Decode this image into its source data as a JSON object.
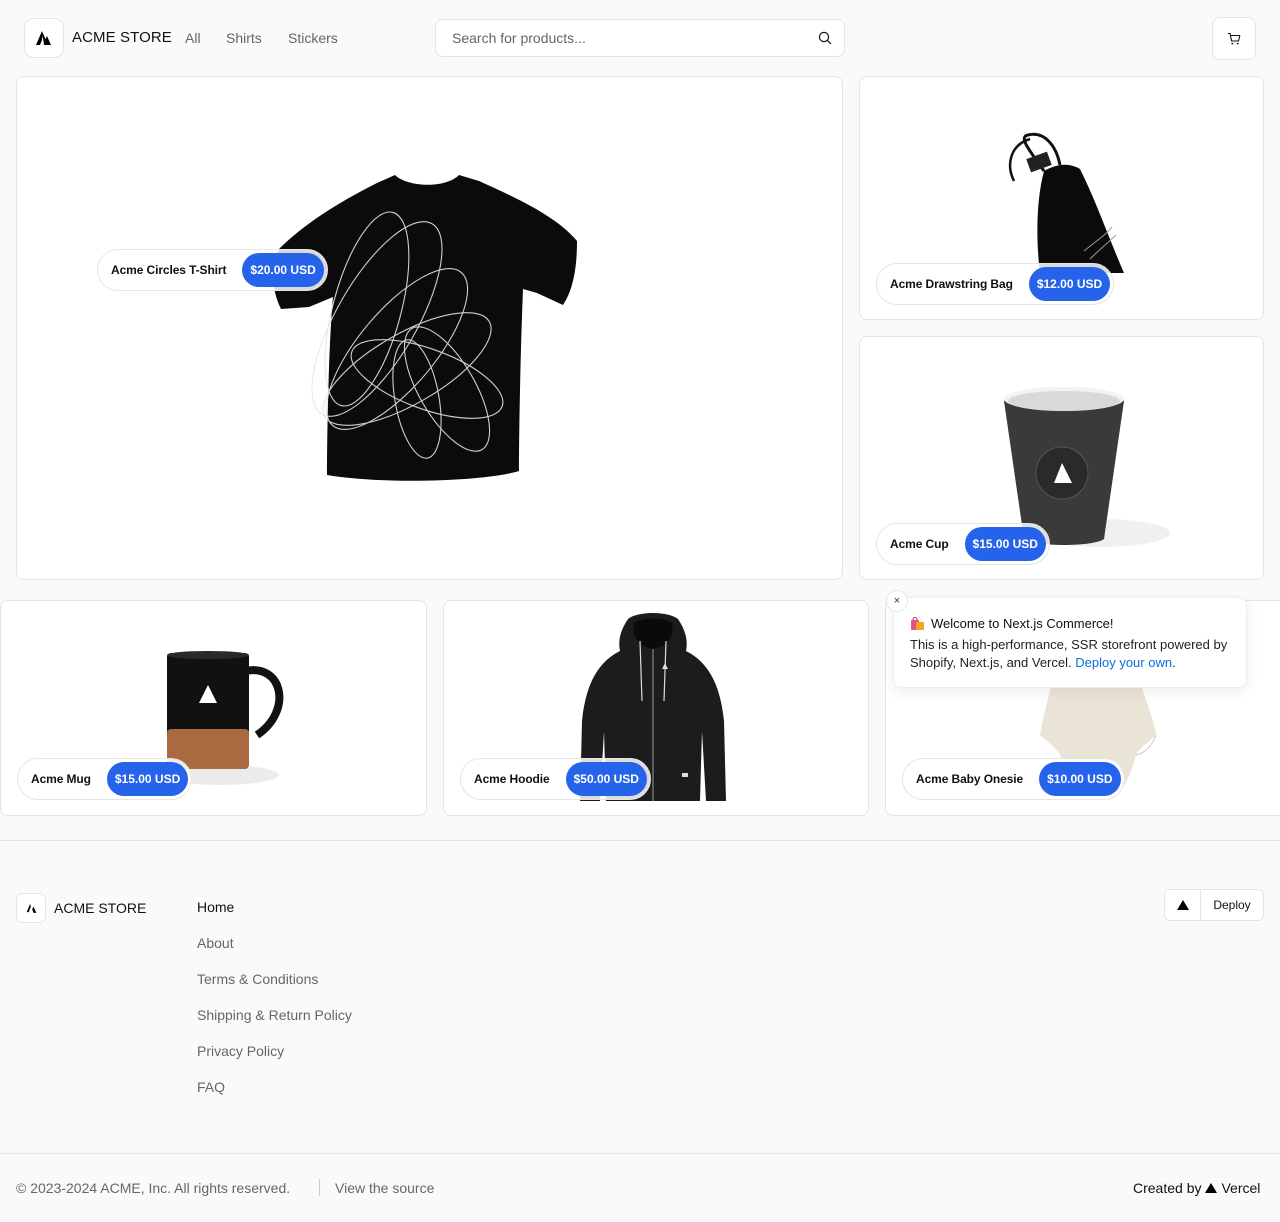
{
  "header": {
    "store_name": "ACME STORE",
    "nav": [
      "All",
      "Shirts",
      "Stickers"
    ],
    "search_placeholder": "Search for products...",
    "icons": [
      "acme-logo-icon",
      "search-icon",
      "cart-icon"
    ]
  },
  "products": [
    {
      "name": "Acme Circles T-Shirt",
      "price": "$20.00 USD"
    },
    {
      "name": "Acme Drawstring Bag",
      "price": "$12.00 USD"
    },
    {
      "name": "Acme Cup",
      "price": "$15.00 USD"
    },
    {
      "name": "Acme Mug",
      "price": "$15.00 USD"
    },
    {
      "name": "Acme Hoodie",
      "price": "$50.00 USD"
    },
    {
      "name": "Acme Baby Onesie",
      "price": "$10.00 USD"
    }
  ],
  "toast": {
    "title": "Welcome to Next.js Commerce!",
    "body": "This is a high-performance, SSR storefront powered by Shopify, Next.js, and Vercel.",
    "link": "Deploy your own",
    "close": "×"
  },
  "footer": {
    "store_name": "ACME STORE",
    "links": [
      "Home",
      "About",
      "Terms & Conditions",
      "Shipping & Return Policy",
      "Privacy Policy",
      "FAQ"
    ],
    "deploy_label": "Deploy",
    "copyright": "© 2023-2024 ACME, Inc. All rights reserved.",
    "source_link": "View the source",
    "created_by": "Created by",
    "vercel": "Vercel"
  },
  "colors": {
    "accent": "#2563eb",
    "background": "#fafafa",
    "border": "#e5e5e5"
  }
}
